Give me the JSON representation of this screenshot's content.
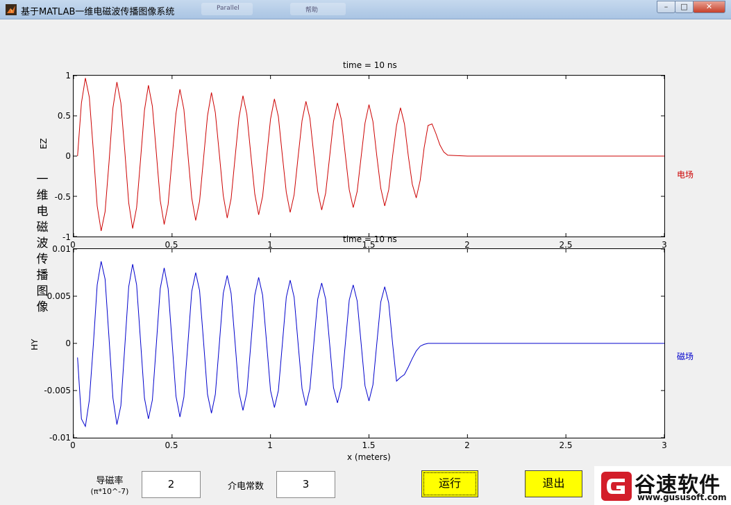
{
  "window": {
    "title": "基于MATLAB一维电磁波传播图像系统",
    "ghost_tab_1": "Parallel",
    "ghost_tab_2": "帮助",
    "minimize_glyph": "–",
    "maximize_glyph": "□",
    "close_glyph": "✕"
  },
  "figure": {
    "vertical_title": [
      "一",
      "维",
      "电",
      "磁",
      "波",
      "传",
      "播",
      "图",
      "像"
    ],
    "top_axes": {
      "title": "time = 10 ns",
      "ylabel": "EZ",
      "side_label": "电场",
      "yticks": [
        "1",
        "0.5",
        "0",
        "-0.5",
        "-1"
      ],
      "xticks": [
        "0",
        "0.5",
        "1",
        "1.5",
        "2",
        "2.5",
        "3"
      ],
      "color": "#cc0000"
    },
    "bottom_axes": {
      "title": "time = 10 ns",
      "ylabel": "HY",
      "xlabel": "x (meters)",
      "side_label": "磁场",
      "yticks": [
        "0.01",
        "0.005",
        "0",
        "-0.005",
        "-0.01"
      ],
      "xticks": [
        "0",
        "0.5",
        "1",
        "1.5",
        "2",
        "2.5",
        "3"
      ],
      "color": "#0000cc"
    }
  },
  "controls": {
    "permeability_label": "导磁率",
    "permeability_unit": "(π*10^-7)",
    "permeability_value": "2",
    "permittivity_label": "介电常数",
    "permittivity_value": "3",
    "run_label": "运行",
    "exit_label": "退出"
  },
  "watermark": {
    "name": "谷速软件",
    "url": "www.gususoft.com"
  },
  "chart_data": [
    {
      "type": "line",
      "title": "time = 10 ns",
      "xlabel": "",
      "ylabel": "EZ",
      "xlim": [
        0,
        3
      ],
      "ylim": [
        -1,
        1
      ],
      "grid": false,
      "series": [
        {
          "name": "电场",
          "color": "#cc0000",
          "x": [
            0.02,
            0.04,
            0.06,
            0.08,
            0.1,
            0.12,
            0.14,
            0.16,
            0.18,
            0.2,
            0.22,
            0.24,
            0.26,
            0.28,
            0.3,
            0.32,
            0.34,
            0.36,
            0.38,
            0.4,
            0.42,
            0.44,
            0.46,
            0.48,
            0.5,
            0.52,
            0.54,
            0.56,
            0.58,
            0.6,
            0.62,
            0.64,
            0.66,
            0.68,
            0.7,
            0.72,
            0.74,
            0.76,
            0.78,
            0.8,
            0.82,
            0.84,
            0.86,
            0.88,
            0.9,
            0.92,
            0.94,
            0.96,
            0.98,
            1.0,
            1.02,
            1.04,
            1.06,
            1.08,
            1.1,
            1.12,
            1.14,
            1.16,
            1.18,
            1.2,
            1.22,
            1.24,
            1.26,
            1.28,
            1.3,
            1.32,
            1.34,
            1.36,
            1.38,
            1.4,
            1.42,
            1.44,
            1.46,
            1.48,
            1.5,
            1.52,
            1.54,
            1.56,
            1.58,
            1.6,
            1.62,
            1.64,
            1.66,
            1.68,
            1.7,
            1.72,
            1.74,
            1.76,
            1.78,
            1.8,
            1.82,
            1.84,
            1.86,
            1.88,
            1.9,
            2.0,
            2.5,
            3.0
          ],
          "y": [
            0.0,
            0.66,
            0.97,
            0.73,
            0.07,
            -0.62,
            -0.93,
            -0.69,
            -0.07,
            0.6,
            0.92,
            0.66,
            0.06,
            -0.58,
            -0.9,
            -0.64,
            -0.05,
            0.57,
            0.88,
            0.62,
            0.05,
            -0.55,
            -0.85,
            -0.6,
            -0.04,
            0.53,
            0.83,
            0.58,
            0.04,
            -0.52,
            -0.8,
            -0.56,
            -0.03,
            0.5,
            0.79,
            0.54,
            0.03,
            -0.49,
            -0.77,
            -0.53,
            -0.02,
            0.48,
            0.75,
            0.52,
            0.02,
            -0.47,
            -0.73,
            -0.5,
            -0.02,
            0.46,
            0.71,
            0.49,
            0.01,
            -0.45,
            -0.7,
            -0.48,
            -0.01,
            0.44,
            0.68,
            0.47,
            0.01,
            -0.44,
            -0.67,
            -0.46,
            -0.01,
            0.43,
            0.66,
            0.45,
            0.01,
            -0.42,
            -0.64,
            -0.44,
            -0.01,
            0.41,
            0.64,
            0.43,
            0.0,
            -0.4,
            -0.62,
            -0.42,
            0.0,
            0.38,
            0.6,
            0.4,
            0.0,
            -0.35,
            -0.52,
            -0.3,
            0.1,
            0.38,
            0.4,
            0.28,
            0.14,
            0.05,
            0.01,
            0.0,
            0.0,
            0.0
          ]
        }
      ]
    },
    {
      "type": "line",
      "title": "time = 10 ns",
      "xlabel": "x (meters)",
      "ylabel": "HY",
      "xlim": [
        0,
        3
      ],
      "ylim": [
        -0.01,
        0.01
      ],
      "grid": false,
      "series": [
        {
          "name": "磁场",
          "color": "#0000cc",
          "x": [
            0.02,
            0.04,
            0.06,
            0.08,
            0.1,
            0.12,
            0.14,
            0.16,
            0.18,
            0.2,
            0.22,
            0.24,
            0.26,
            0.28,
            0.3,
            0.32,
            0.34,
            0.36,
            0.38,
            0.4,
            0.42,
            0.44,
            0.46,
            0.48,
            0.5,
            0.52,
            0.54,
            0.56,
            0.58,
            0.6,
            0.62,
            0.64,
            0.66,
            0.68,
            0.7,
            0.72,
            0.74,
            0.76,
            0.78,
            0.8,
            0.82,
            0.84,
            0.86,
            0.88,
            0.9,
            0.92,
            0.94,
            0.96,
            0.98,
            1.0,
            1.02,
            1.04,
            1.06,
            1.08,
            1.1,
            1.12,
            1.14,
            1.16,
            1.18,
            1.2,
            1.22,
            1.24,
            1.26,
            1.28,
            1.3,
            1.32,
            1.34,
            1.36,
            1.38,
            1.4,
            1.42,
            1.44,
            1.46,
            1.48,
            1.5,
            1.52,
            1.54,
            1.56,
            1.58,
            1.6,
            1.62,
            1.64,
            1.66,
            1.68,
            1.7,
            1.72,
            1.74,
            1.76,
            1.78,
            1.8,
            1.82,
            1.84,
            1.86,
            1.88,
            1.9,
            2.0,
            2.5,
            3.0
          ],
          "y": [
            -0.0015,
            -0.008,
            -0.0088,
            -0.006,
            -0.0002,
            0.0062,
            0.0087,
            0.0068,
            0.0005,
            -0.0058,
            -0.0086,
            -0.0066,
            -0.0003,
            0.006,
            0.0084,
            0.0062,
            0.0003,
            -0.0058,
            -0.008,
            -0.006,
            -0.0002,
            0.0058,
            0.008,
            0.0058,
            0.0002,
            -0.0056,
            -0.0078,
            -0.0057,
            -0.0002,
            0.0055,
            0.0075,
            0.0056,
            0.0002,
            -0.0054,
            -0.0074,
            -0.0054,
            -0.0001,
            0.0053,
            0.0072,
            0.0053,
            0.0001,
            -0.0052,
            -0.0071,
            -0.0052,
            -0.0001,
            0.0051,
            0.007,
            0.0051,
            0.0001,
            -0.005,
            -0.0068,
            -0.005,
            -0.0001,
            0.0049,
            0.0067,
            0.0049,
            0.0,
            -0.0048,
            -0.0066,
            -0.0048,
            0.0,
            0.0047,
            0.0064,
            0.0047,
            0.0,
            -0.0047,
            -0.0063,
            -0.0046,
            0.0,
            0.0046,
            0.0062,
            0.0045,
            0.0,
            -0.0045,
            -0.0061,
            -0.0044,
            0.0,
            0.0044,
            0.006,
            0.0043,
            0.0,
            -0.004,
            -0.0036,
            -0.0033,
            -0.0025,
            -0.0016,
            -0.0008,
            -0.0003,
            -0.0001,
            0.0,
            0.0,
            0.0,
            0.0,
            0.0,
            0.0,
            0.0,
            0.0,
            0.0
          ]
        }
      ]
    }
  ]
}
